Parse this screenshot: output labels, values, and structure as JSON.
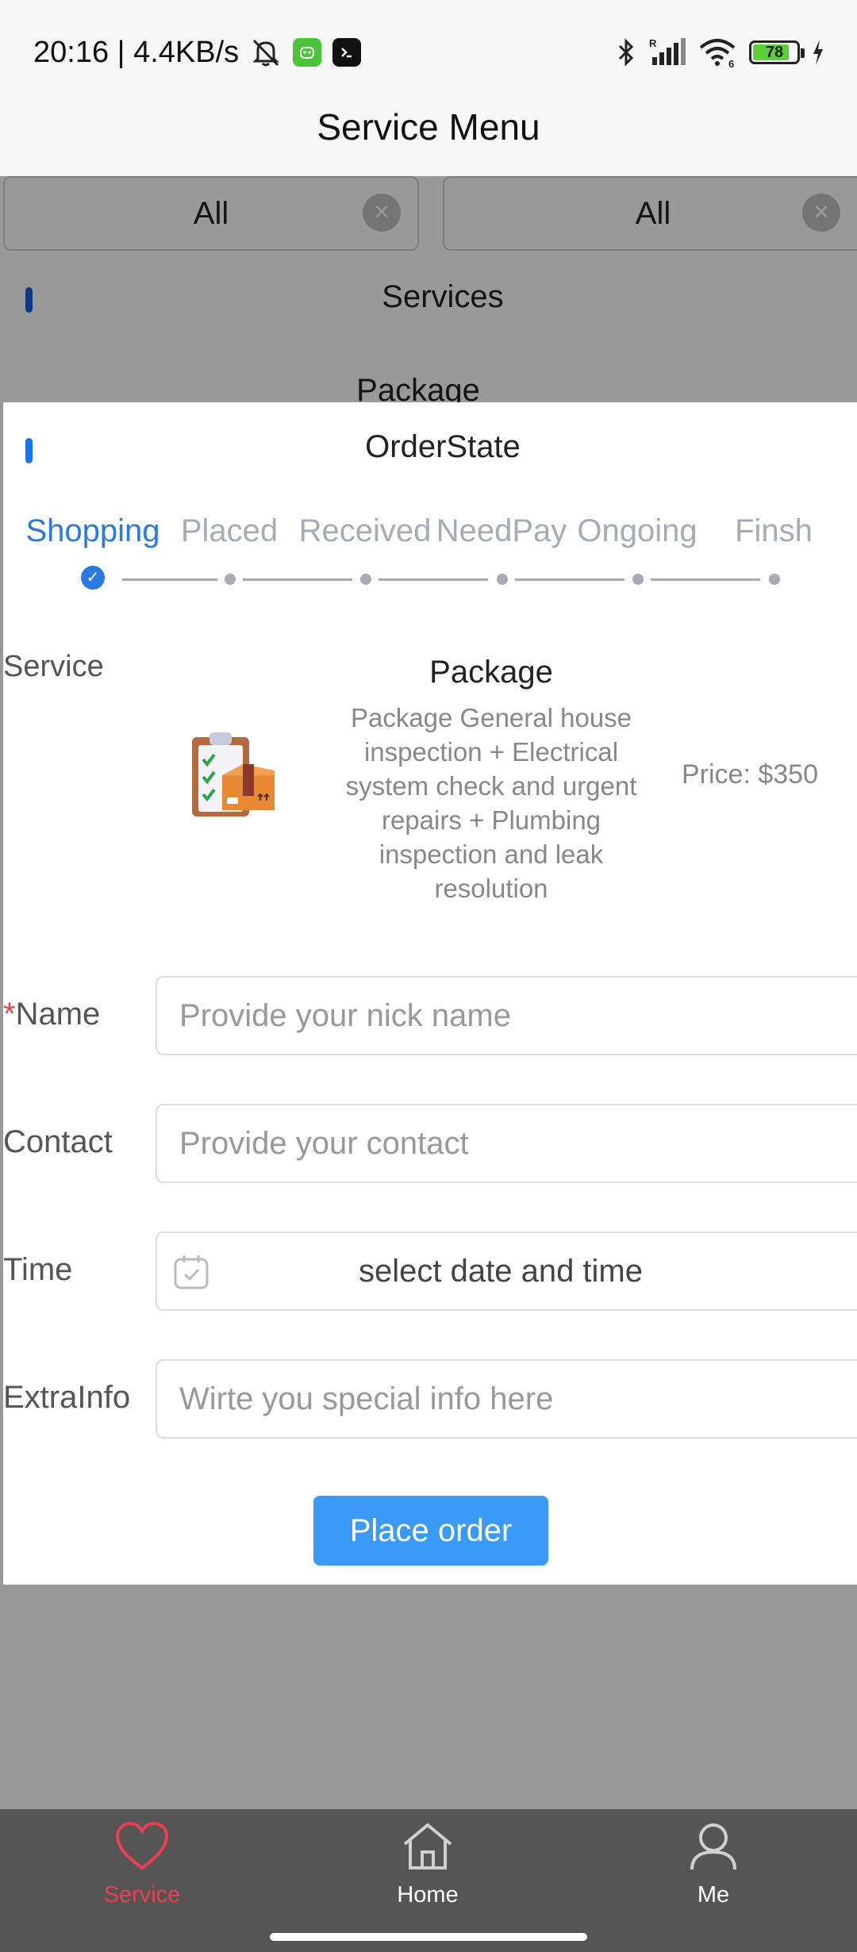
{
  "status_bar": {
    "time_speed": "20:16 | 4.4KB/s",
    "battery_level": "78",
    "signal_r_badge": "R",
    "wifi_badge": "6"
  },
  "header": {
    "title": "Service Menu"
  },
  "filters": [
    {
      "value": "All",
      "clear_icon": "close-circle-icon"
    },
    {
      "value": "All",
      "clear_icon": "close-circle-icon"
    }
  ],
  "background_sections": {
    "services_title": "Services",
    "package_title": "Package"
  },
  "modal": {
    "title": "OrderState",
    "steps": [
      "Shopping",
      "Placed",
      "Received",
      "NeedPay",
      "Ongoing",
      "Finsh"
    ],
    "active_step_index": 0,
    "service": {
      "label": "Service",
      "name": "Package",
      "description": "Package General house inspection + Electrical system check and urgent repairs + Plumbing inspection and leak resolution",
      "price": "Price: $350"
    },
    "form": {
      "name_label": "Name",
      "name_required_mark": "*",
      "name_placeholder": "Provide your nick name",
      "contact_label": "Contact",
      "contact_placeholder": "Provide your contact",
      "time_label": "Time",
      "time_value": "select date and time",
      "extra_label": "ExtraInfo",
      "extra_placeholder": "Wirte you special info here"
    },
    "submit_label": "Place order"
  },
  "tab_bar": {
    "items": [
      {
        "label": "Service",
        "icon": "heart-icon",
        "active": true
      },
      {
        "label": "Home",
        "icon": "home-icon",
        "active": false
      },
      {
        "label": "Me",
        "icon": "person-icon",
        "active": false
      }
    ]
  },
  "colors": {
    "accent": "#2a7ae2",
    "button": "#3a9af7",
    "active_tab": "#e8404e",
    "tab_bar_bg": "#555555"
  }
}
